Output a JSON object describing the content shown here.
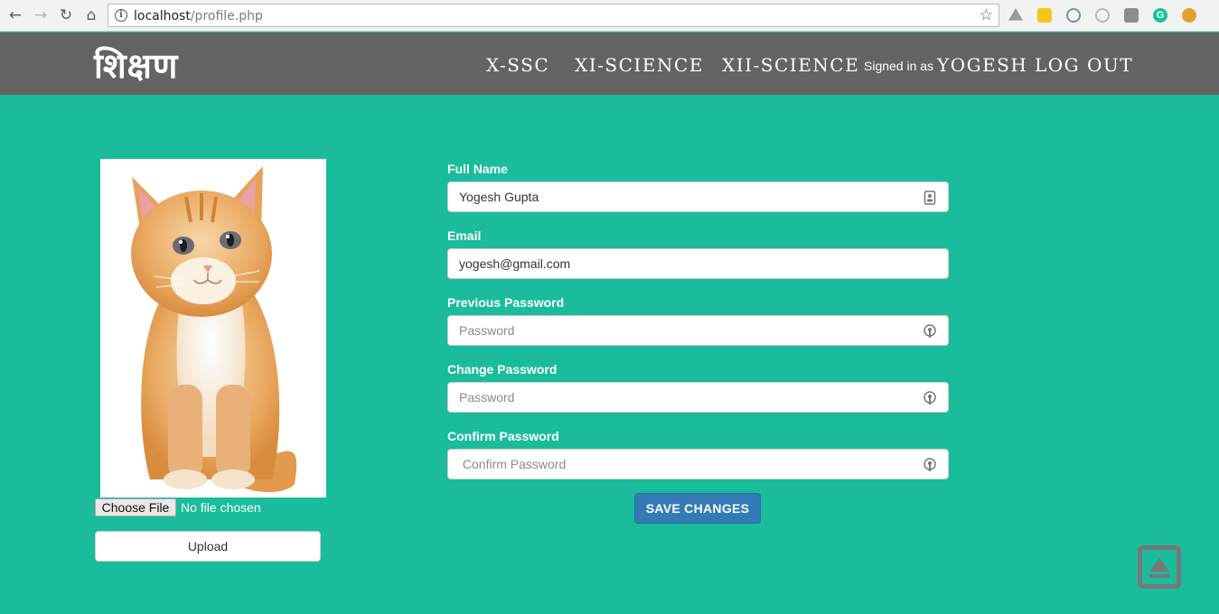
{
  "browser": {
    "url_host": "localhost",
    "url_path": "/profile.php",
    "extensions": [
      "drive-icon",
      "yellow-extension-icon",
      "react-devtools-icon",
      "settings-extension-icon",
      "screen-capture-icon",
      "grammarly-icon",
      "bug-extension-icon"
    ]
  },
  "navbar": {
    "brand": "शिक्षण",
    "links": [
      "X-SSC",
      "XI-SCIENCE",
      "XII-SCIENCE"
    ],
    "signed_in_label": "Signed in as",
    "username": "YOGESH",
    "logout": "LOG OUT"
  },
  "profile": {
    "file_button": "Choose File",
    "file_status": "No file chosen",
    "upload": "Upload"
  },
  "form": {
    "full_name": {
      "label": "Full Name",
      "value": "Yogesh Gupta"
    },
    "email": {
      "label": "Email",
      "value": "yogesh@gmail.com"
    },
    "previous_password": {
      "label": "Previous Password",
      "placeholder": "Password"
    },
    "change_password": {
      "label": "Change Password",
      "placeholder": "Password"
    },
    "confirm_password": {
      "label": "Confirm Password",
      "placeholder": " Confirm Password"
    },
    "save": "SAVE CHANGES"
  },
  "colors": {
    "page_background": "#1abc9c",
    "navbar": "#636363",
    "primary_button": "#337ab7"
  }
}
